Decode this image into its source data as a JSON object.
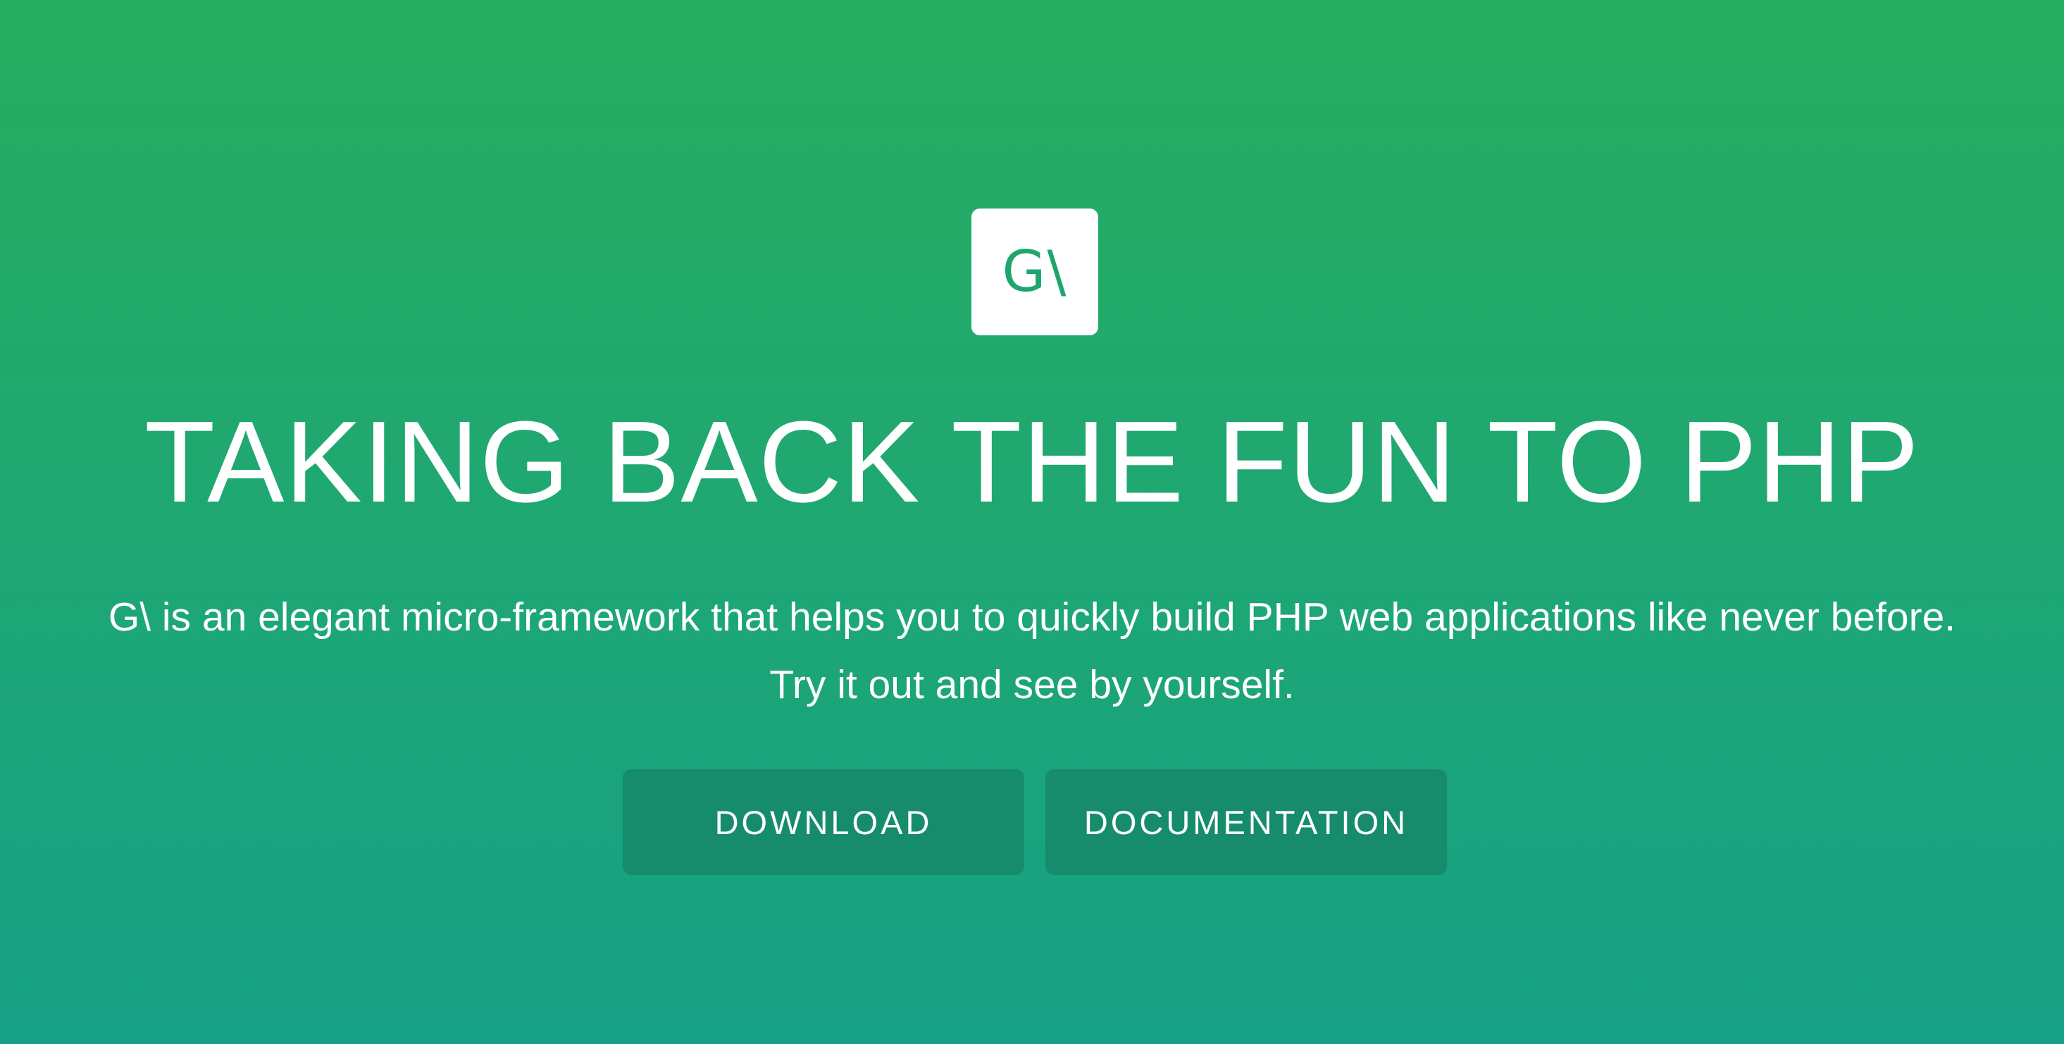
{
  "logo": {
    "text": "G\\"
  },
  "headline": "TAKING BACK THE FUN TO PHP",
  "subtitle": {
    "line1": "G\\ is an elegant micro-framework that helps you to quickly build PHP web applications like never before.",
    "line2": "Try it out and see by yourself."
  },
  "buttons": {
    "download": "DOWNLOAD",
    "documentation": "DOCUMENTATION"
  },
  "colors": {
    "gradient_top": "#27ae60",
    "gradient_bottom": "#16a085",
    "button_bg": "#168c6c",
    "logo_bg": "#ffffff",
    "logo_text": "#1fa66e"
  }
}
